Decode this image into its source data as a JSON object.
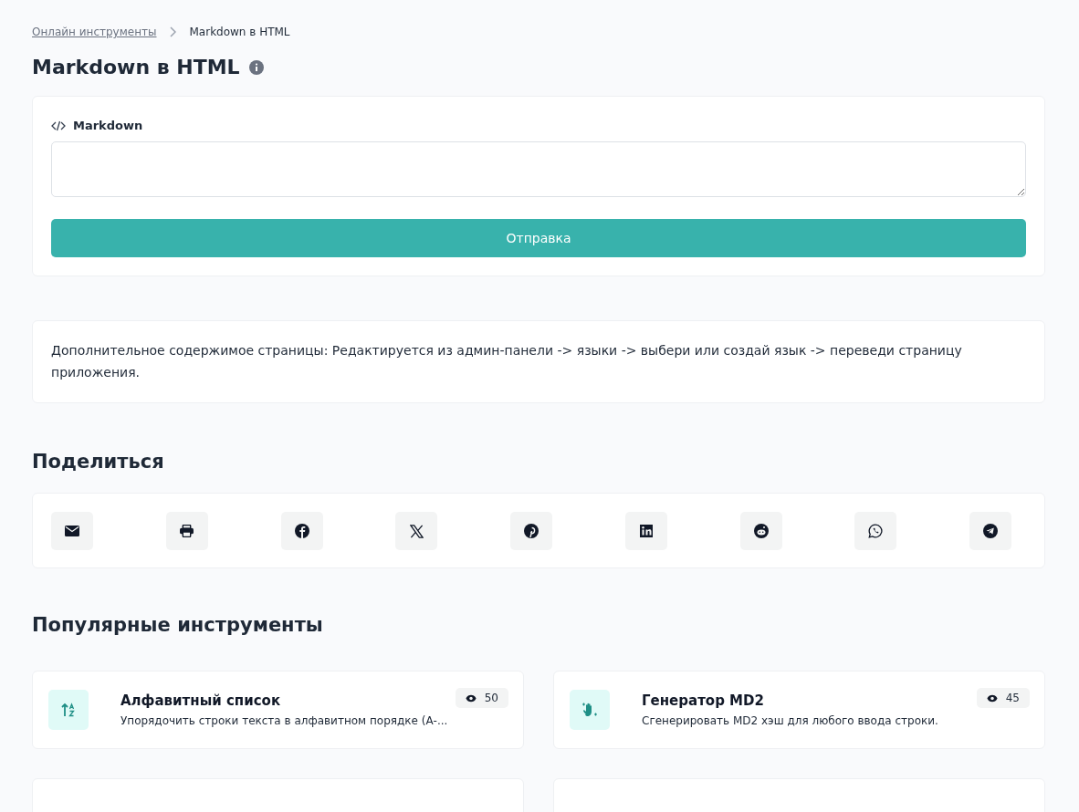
{
  "breadcrumb": [
    {
      "label": "Онлайн инструменты",
      "kind": "link"
    },
    {
      "label": "Markdown в HTML",
      "kind": "current"
    }
  ],
  "page_title": "Markdown в HTML",
  "form": {
    "field_label": "Markdown",
    "submit": "Отправка"
  },
  "content_note": "Дополнительное содержимое страницы: Редактируется из админ-панели -> языки -> выбери или создай язык -> переведи страницу приложения.",
  "share": {
    "title": "Поделиться",
    "buttons": [
      {
        "kind": "email"
      },
      {
        "kind": "print"
      },
      {
        "kind": "facebook"
      },
      {
        "kind": "x"
      },
      {
        "kind": "pinterest"
      },
      {
        "kind": "linkedin"
      },
      {
        "kind": "reddit"
      },
      {
        "kind": "whatsapp"
      },
      {
        "kind": "telegram"
      }
    ]
  },
  "popular": {
    "title": "Популярные инструменты",
    "tools": [
      {
        "kind": "sort",
        "title": "Алфавитный список",
        "description": "Упорядочить строки текста в алфавитном порядке (А-...",
        "views": "50"
      },
      {
        "kind": "hash",
        "title": "Генератор MD2",
        "description": "Сгенерировать MD2 хэш для любого ввода строки.",
        "views": "45"
      }
    ]
  }
}
